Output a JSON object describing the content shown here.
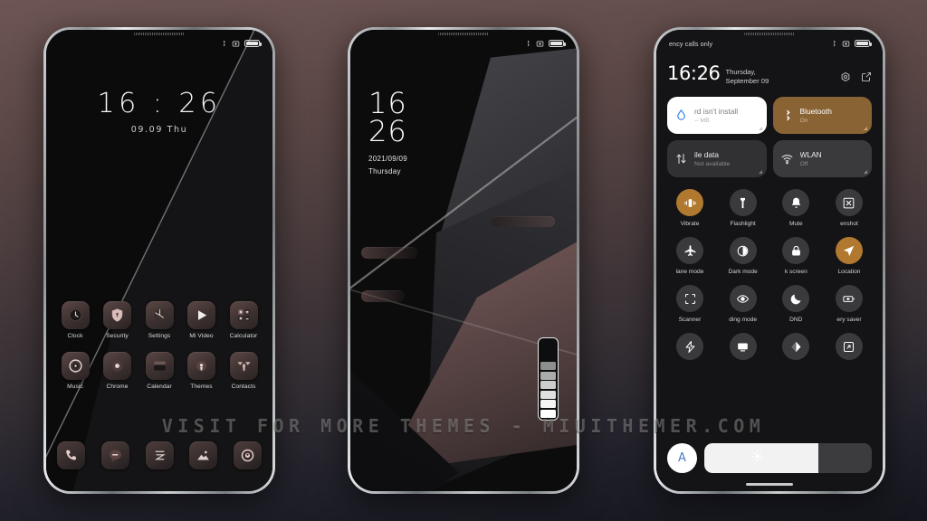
{
  "background": {
    "top_color": "#6d5553",
    "bottom_color": "#15151d"
  },
  "watermark": {
    "text": "VISIT  FOR  MORE  THEMES  -  MIUITHEMER.COM"
  },
  "phone_home": {
    "status_bar": {
      "left_text": "",
      "icons": [
        "bluetooth-icon",
        "dnd-icon",
        "battery-icon"
      ]
    },
    "clock_widget": {
      "time": "16 : 26",
      "date": "09.09  Thu"
    },
    "apps": [
      {
        "label": "Clock",
        "icon": "clock-icon"
      },
      {
        "label": "Security",
        "icon": "shield-icon"
      },
      {
        "label": "Settings",
        "icon": "settings-gear-icon"
      },
      {
        "label": "Mi Video",
        "icon": "play-icon"
      },
      {
        "label": "Calculator",
        "icon": "calculator-icon"
      },
      {
        "label": "Music",
        "icon": "music-disc-icon"
      },
      {
        "label": "Chrome",
        "icon": "chrome-icon"
      },
      {
        "label": "Calendar",
        "icon": "calendar-icon"
      },
      {
        "label": "Themes",
        "icon": "themes-icon"
      },
      {
        "label": "Contacts",
        "icon": "contacts-icon"
      }
    ],
    "dock": [
      {
        "name": "phone-icon"
      },
      {
        "name": "messages-icon"
      },
      {
        "name": "notes-icon"
      },
      {
        "name": "gallery-icon"
      },
      {
        "name": "camera-icon"
      }
    ]
  },
  "phone_lock": {
    "status_bar": {
      "icons": [
        "bluetooth-icon",
        "dnd-icon",
        "battery-icon"
      ]
    },
    "clock": {
      "hour": "16",
      "minute": "26",
      "date": "2021/09/09",
      "weekday": "Thursday"
    },
    "volume_widget": {
      "segments": 6,
      "filled": 6
    }
  },
  "phone_control_center": {
    "status_bar": {
      "carrier": "ency calls only",
      "icons": [
        "bluetooth-icon",
        "dnd-icon",
        "battery-icon"
      ]
    },
    "header": {
      "time": "16:26",
      "date": "Thursday, September 09",
      "settings_icon": "gear-icon",
      "edit_icon": "edit-icon"
    },
    "big_tiles": [
      {
        "title": "rd isn't install",
        "subtitle": "-- MB",
        "icon": "water-drop-icon",
        "style": "white",
        "state": "off"
      },
      {
        "title": "Bluetooth",
        "subtitle": "On",
        "icon": "bluetooth-icon",
        "style": "gold",
        "state": "on"
      },
      {
        "title": "ile data",
        "subtitle": "Not available",
        "icon": "data-transfer-icon",
        "style": "dgrey",
        "state": "off"
      },
      {
        "title": "WLAN",
        "subtitle": "Off",
        "icon": "wifi-icon",
        "style": "grey",
        "state": "off"
      }
    ],
    "toggles": [
      {
        "label": "Vibrate",
        "icon": "vibrate-icon",
        "state": "on"
      },
      {
        "label": "Flashlight",
        "icon": "flashlight-icon",
        "state": "off"
      },
      {
        "label": "Mute",
        "icon": "bell-icon",
        "state": "off"
      },
      {
        "label": "enshot",
        "icon": "screenshot-icon",
        "state": "off"
      },
      {
        "label": "lane mode",
        "icon": "airplane-icon",
        "state": "off"
      },
      {
        "label": "Dark mode",
        "icon": "dark-mode-icon",
        "state": "off"
      },
      {
        "label": "k screen",
        "icon": "lock-icon",
        "state": "off"
      },
      {
        "label": "Location",
        "icon": "location-arrow-icon",
        "state": "on"
      },
      {
        "label": "Scanner",
        "icon": "scanner-icon",
        "state": "off"
      },
      {
        "label": "ding mode",
        "icon": "eye-icon",
        "state": "off"
      },
      {
        "label": "DND",
        "icon": "moon-icon",
        "state": "off"
      },
      {
        "label": "ery saver",
        "icon": "battery-saver-icon",
        "state": "off"
      },
      {
        "label": "",
        "icon": "lightning-icon",
        "state": "off"
      },
      {
        "label": "",
        "icon": "cast-icon",
        "state": "off"
      },
      {
        "label": "",
        "icon": "sync-icon",
        "state": "off"
      },
      {
        "label": "",
        "icon": "screen-rotate-icon",
        "state": "off"
      }
    ],
    "brightness": {
      "auto_label": "A",
      "value_percent": 68,
      "icon": "sun-icon"
    }
  }
}
